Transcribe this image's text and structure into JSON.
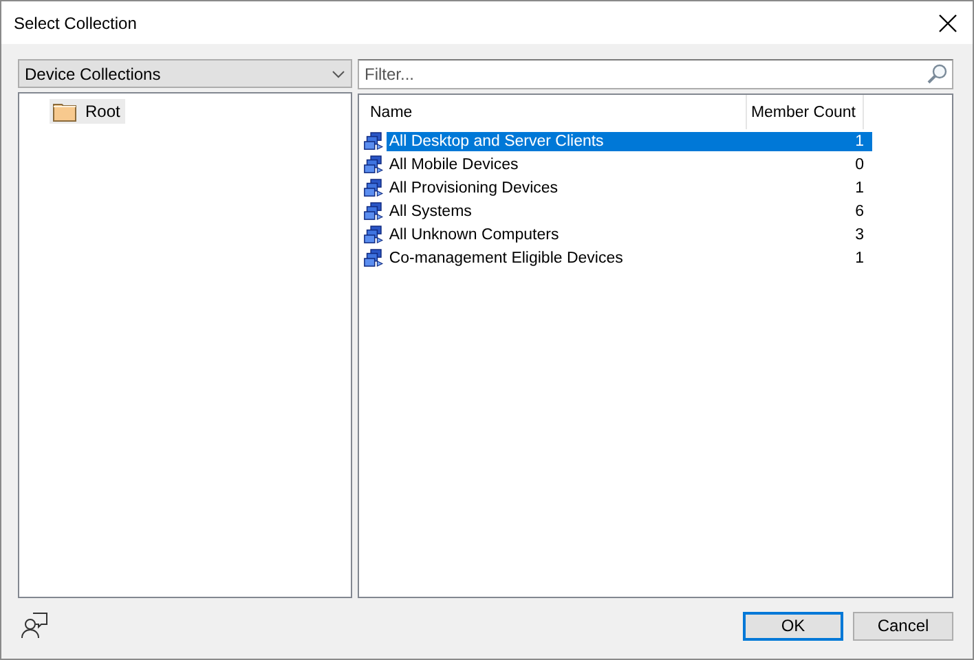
{
  "window": {
    "title": "Select Collection"
  },
  "collection_type": {
    "value": "Device Collections"
  },
  "tree": {
    "items": [
      {
        "label": "Root",
        "selected": true
      }
    ]
  },
  "filter": {
    "placeholder": "Filter..."
  },
  "table": {
    "columns": [
      "Name",
      "Member Count"
    ],
    "rows": [
      {
        "name": "All Desktop and Server Clients",
        "count": "1",
        "selected": true
      },
      {
        "name": "All Mobile Devices",
        "count": "0",
        "selected": false
      },
      {
        "name": "All Provisioning Devices",
        "count": "1",
        "selected": false
      },
      {
        "name": "All Systems",
        "count": "6",
        "selected": false
      },
      {
        "name": "All Unknown Computers",
        "count": "3",
        "selected": false
      },
      {
        "name": "Co-management Eligible Devices",
        "count": "1",
        "selected": false
      }
    ]
  },
  "buttons": [
    {
      "label": "OK",
      "default": true
    },
    {
      "label": "Cancel",
      "default": false
    }
  ]
}
